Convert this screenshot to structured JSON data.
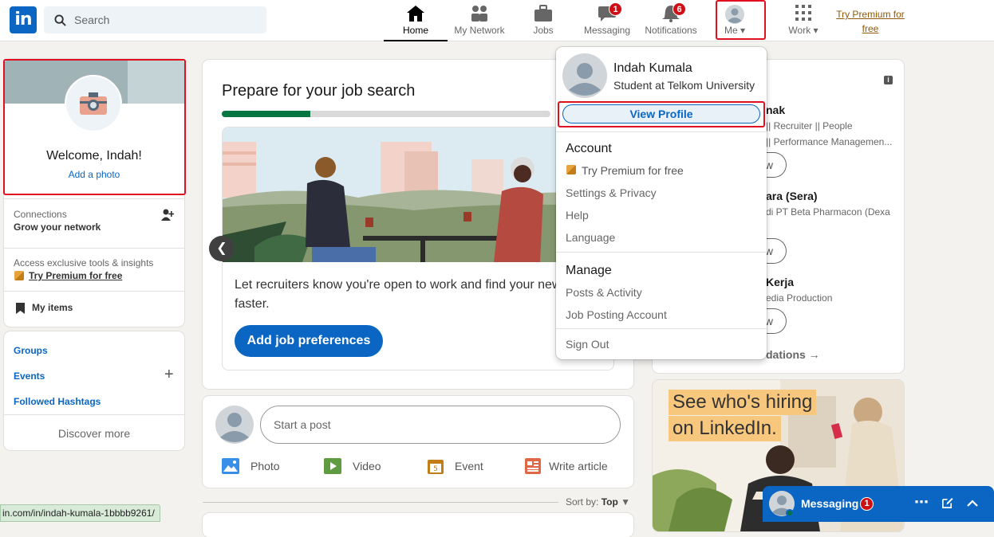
{
  "header": {
    "logo_text": "in",
    "search_placeholder": "Search",
    "nav": [
      {
        "label": "Home",
        "icon": "home-icon"
      },
      {
        "label": "My Network",
        "icon": "network-icon"
      },
      {
        "label": "Jobs",
        "icon": "briefcase-icon"
      },
      {
        "label": "Messaging",
        "icon": "chat-icon",
        "badge": "1"
      },
      {
        "label": "Notifications",
        "icon": "bell-icon",
        "badge": "6"
      },
      {
        "label": "Me",
        "icon": "avatar-icon"
      },
      {
        "label": "Work",
        "icon": "grid-icon"
      }
    ],
    "premium_link": "Try Premium for free"
  },
  "profile_card": {
    "welcome": "Welcome, Indah!",
    "add_photo": "Add a photo",
    "connections_label": "Connections",
    "connections_sub": "Grow your network",
    "premium_insight": "Access exclusive tools & insights",
    "premium_link": "Try Premium for free",
    "my_items": "My items"
  },
  "links_card": {
    "groups": "Groups",
    "events": "Events",
    "hashtags": "Followed Hashtags",
    "discover": "Discover more"
  },
  "job_card": {
    "title": "Prepare for your job search",
    "progress": 0.27,
    "body": "Let recruiters know you're open to work and find your new job faster.",
    "button": "Add job preferences"
  },
  "post_box": {
    "placeholder": "Start a post",
    "actions": [
      "Photo",
      "Video",
      "Event",
      "Write article"
    ]
  },
  "sort": {
    "label": "Sort by:",
    "value": "Top"
  },
  "me_menu": {
    "name": "Indah Kumala",
    "headline": "Student at Telkom University",
    "view_profile": "View Profile",
    "account_heading": "Account",
    "account_items": [
      "Try Premium for free",
      "Settings & Privacy",
      "Help",
      "Language"
    ],
    "manage_heading": "Manage",
    "manage_items": [
      "Posts & Activity",
      "Job Posting Account"
    ],
    "sign_out": "Sign Out"
  },
  "right_feed": {
    "p1_name": "nak",
    "p1_line1": "|| Recruiter || People",
    "p1_line2": "|| Performance Managemen...",
    "p2_name": "ara (Sera)",
    "p2_line1": "di PT Beta Pharmacon (Dexa",
    "p3_name": "Kerja",
    "p3_line1": "edia Production",
    "follow_btn": "w",
    "recommendations": "dations"
  },
  "ad": {
    "line1": "See who's hiring",
    "line2": "on LinkedIn."
  },
  "messaging": {
    "label": "Messaging",
    "badge": "1"
  },
  "status_url": "in.com/in/indah-kumala-1bbbb9261/",
  "colors": {
    "brand": "#0a66c2",
    "badge": "#cc1016",
    "premium": "#915907",
    "highlight": "#e01020"
  }
}
